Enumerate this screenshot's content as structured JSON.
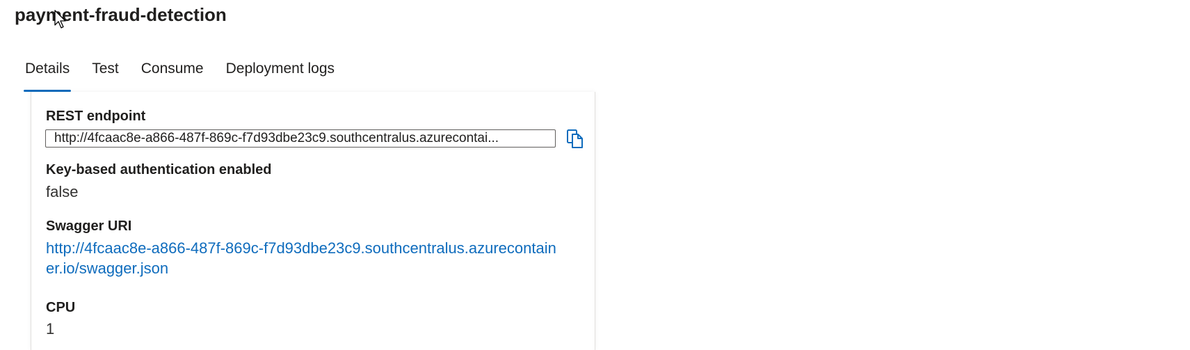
{
  "header": {
    "title": "payment-fraud-detection"
  },
  "tabs": [
    {
      "label": "Details",
      "active": true
    },
    {
      "label": "Test",
      "active": false
    },
    {
      "label": "Consume",
      "active": false
    },
    {
      "label": "Deployment logs",
      "active": false
    }
  ],
  "details": {
    "rest_endpoint": {
      "label": "REST endpoint",
      "value": "http://4fcaac8e-a866-487f-869c-f7d93dbe23c9.southcentralus.azurecontai..."
    },
    "key_auth": {
      "label": "Key-based authentication enabled",
      "value": "false"
    },
    "swagger": {
      "label": "Swagger URI",
      "value": "http://4fcaac8e-a866-487f-869c-f7d93dbe23c9.southcentralus.azurecontainer.io/swagger.json"
    },
    "cpu": {
      "label": "CPU",
      "value": "1"
    }
  },
  "icons": {
    "copy": "copy-icon",
    "cursor": "mouse-pointer-icon"
  },
  "colors": {
    "accent": "#0f6cbd",
    "link": "#0f6cbd",
    "text": "#201f1e"
  }
}
